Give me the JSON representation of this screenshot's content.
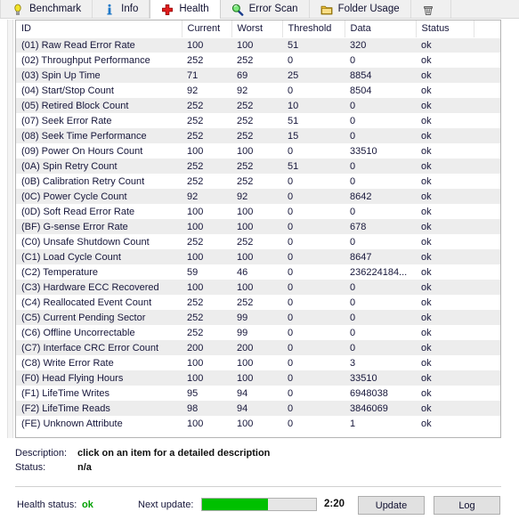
{
  "tabs": [
    {
      "label": "Benchmark",
      "icon": "lightbulb-icon",
      "active": false
    },
    {
      "label": "Info",
      "icon": "info-icon",
      "active": false
    },
    {
      "label": "Health",
      "icon": "red-cross-icon",
      "active": true
    },
    {
      "label": "Error Scan",
      "icon": "magnifier-icon",
      "active": false
    },
    {
      "label": "Folder Usage",
      "icon": "folder-icon",
      "active": false
    },
    {
      "label": "",
      "icon": "trash-icon",
      "active": false
    }
  ],
  "table": {
    "columns": [
      "ID",
      "Current",
      "Worst",
      "Threshold",
      "Data",
      "Status"
    ],
    "rows": [
      {
        "id": "(01) Raw Read Error Rate",
        "current": "100",
        "worst": "100",
        "threshold": "51",
        "data": "320",
        "status": "ok"
      },
      {
        "id": "(02) Throughput Performance",
        "current": "252",
        "worst": "252",
        "threshold": "0",
        "data": "0",
        "status": "ok"
      },
      {
        "id": "(03) Spin Up Time",
        "current": "71",
        "worst": "69",
        "threshold": "25",
        "data": "8854",
        "status": "ok"
      },
      {
        "id": "(04) Start/Stop Count",
        "current": "92",
        "worst": "92",
        "threshold": "0",
        "data": "8504",
        "status": "ok"
      },
      {
        "id": "(05) Retired Block Count",
        "current": "252",
        "worst": "252",
        "threshold": "10",
        "data": "0",
        "status": "ok"
      },
      {
        "id": "(07) Seek Error Rate",
        "current": "252",
        "worst": "252",
        "threshold": "51",
        "data": "0",
        "status": "ok"
      },
      {
        "id": "(08) Seek Time Performance",
        "current": "252",
        "worst": "252",
        "threshold": "15",
        "data": "0",
        "status": "ok"
      },
      {
        "id": "(09) Power On Hours Count",
        "current": "100",
        "worst": "100",
        "threshold": "0",
        "data": "33510",
        "status": "ok"
      },
      {
        "id": "(0A) Spin Retry Count",
        "current": "252",
        "worst": "252",
        "threshold": "51",
        "data": "0",
        "status": "ok"
      },
      {
        "id": "(0B) Calibration Retry Count",
        "current": "252",
        "worst": "252",
        "threshold": "0",
        "data": "0",
        "status": "ok"
      },
      {
        "id": "(0C) Power Cycle Count",
        "current": "92",
        "worst": "92",
        "threshold": "0",
        "data": "8642",
        "status": "ok"
      },
      {
        "id": "(0D) Soft Read Error Rate",
        "current": "100",
        "worst": "100",
        "threshold": "0",
        "data": "0",
        "status": "ok"
      },
      {
        "id": "(BF) G-sense Error Rate",
        "current": "100",
        "worst": "100",
        "threshold": "0",
        "data": "678",
        "status": "ok"
      },
      {
        "id": "(C0) Unsafe Shutdown Count",
        "current": "252",
        "worst": "252",
        "threshold": "0",
        "data": "0",
        "status": "ok"
      },
      {
        "id": "(C1) Load Cycle Count",
        "current": "100",
        "worst": "100",
        "threshold": "0",
        "data": "8647",
        "status": "ok"
      },
      {
        "id": "(C2) Temperature",
        "current": "59",
        "worst": "46",
        "threshold": "0",
        "data": "236224184...",
        "status": "ok"
      },
      {
        "id": "(C3) Hardware ECC Recovered",
        "current": "100",
        "worst": "100",
        "threshold": "0",
        "data": "0",
        "status": "ok"
      },
      {
        "id": "(C4) Reallocated Event Count",
        "current": "252",
        "worst": "252",
        "threshold": "0",
        "data": "0",
        "status": "ok"
      },
      {
        "id": "(C5) Current Pending Sector",
        "current": "252",
        "worst": "99",
        "threshold": "0",
        "data": "0",
        "status": "ok"
      },
      {
        "id": "(C6) Offline Uncorrectable",
        "current": "252",
        "worst": "99",
        "threshold": "0",
        "data": "0",
        "status": "ok"
      },
      {
        "id": "(C7) Interface CRC Error Count",
        "current": "200",
        "worst": "200",
        "threshold": "0",
        "data": "0",
        "status": "ok"
      },
      {
        "id": "(C8) Write Error Rate",
        "current": "100",
        "worst": "100",
        "threshold": "0",
        "data": "3",
        "status": "ok"
      },
      {
        "id": "(F0) Head Flying Hours",
        "current": "100",
        "worst": "100",
        "threshold": "0",
        "data": "33510",
        "status": "ok"
      },
      {
        "id": "(F1) LifeTime Writes",
        "current": "95",
        "worst": "94",
        "threshold": "0",
        "data": "6948038",
        "status": "ok"
      },
      {
        "id": "(F2) LifeTime Reads",
        "current": "98",
        "worst": "94",
        "threshold": "0",
        "data": "3846069",
        "status": "ok"
      },
      {
        "id": "(FE) Unknown Attribute",
        "current": "100",
        "worst": "100",
        "threshold": "0",
        "data": "1",
        "status": "ok"
      }
    ]
  },
  "details": {
    "description_label": "Description:",
    "description_value": "click on an item for a detailed description",
    "status_label": "Status:",
    "status_value": "n/a"
  },
  "footer": {
    "health_status_label": "Health status:",
    "health_status_value": "ok",
    "health_status_color": "#00a000",
    "next_update_label": "Next update:",
    "progress_percent": 58,
    "progress_color": "#00c000",
    "time_remaining": "2:20",
    "update_button": "Update",
    "log_button": "Log"
  }
}
